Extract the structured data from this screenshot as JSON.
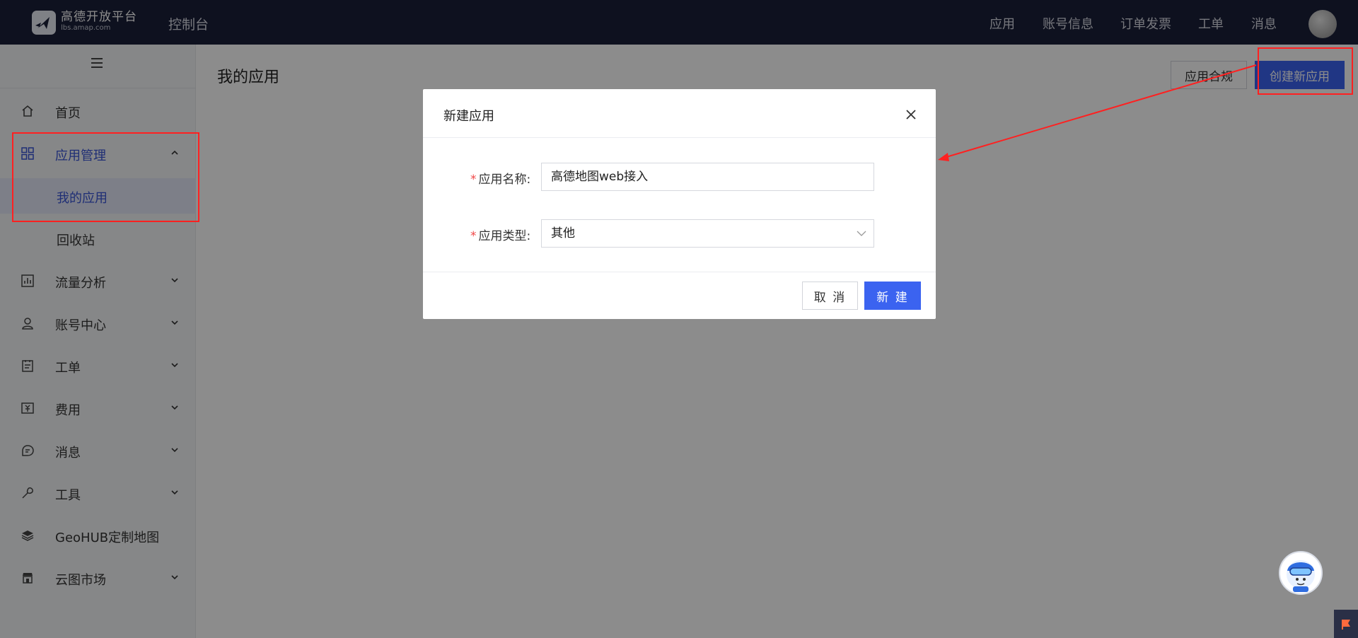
{
  "topbar": {
    "logo_main": "高德开放平台",
    "logo_sub": "lbs.amap.com",
    "console": "控制台",
    "nav": [
      "应用",
      "账号信息",
      "订单发票",
      "工单",
      "消息"
    ]
  },
  "sidebar": {
    "items": [
      {
        "label": "首页",
        "icon": "home-icon"
      },
      {
        "label": "应用管理",
        "icon": "grid-icon",
        "expanded": true
      },
      {
        "label": "我的应用",
        "sub": true,
        "active": true
      },
      {
        "label": "回收站",
        "sub": true
      },
      {
        "label": "流量分析",
        "icon": "chart-icon"
      },
      {
        "label": "账号中心",
        "icon": "user-icon"
      },
      {
        "label": "工单",
        "icon": "ticket-icon"
      },
      {
        "label": "费用",
        "icon": "money-icon"
      },
      {
        "label": "消息",
        "icon": "message-icon"
      },
      {
        "label": "工具",
        "icon": "wrench-icon"
      },
      {
        "label": "GeoHUB定制地图",
        "icon": "layers-icon"
      },
      {
        "label": "云图市场",
        "icon": "store-icon"
      }
    ]
  },
  "main": {
    "title": "我的应用",
    "comply_button": "应用合规",
    "create_button": "创建新应用"
  },
  "modal": {
    "title": "新建应用",
    "name_label": "应用名称:",
    "name_value": "高德地图web接入",
    "type_label": "应用类型:",
    "type_value": "其他",
    "cancel": "取 消",
    "ok": "新 建"
  },
  "colors": {
    "topbar_bg": "#1a1f3a",
    "primary": "#3b63f0",
    "active_text": "#3955d6",
    "annotation": "#ff2020"
  }
}
